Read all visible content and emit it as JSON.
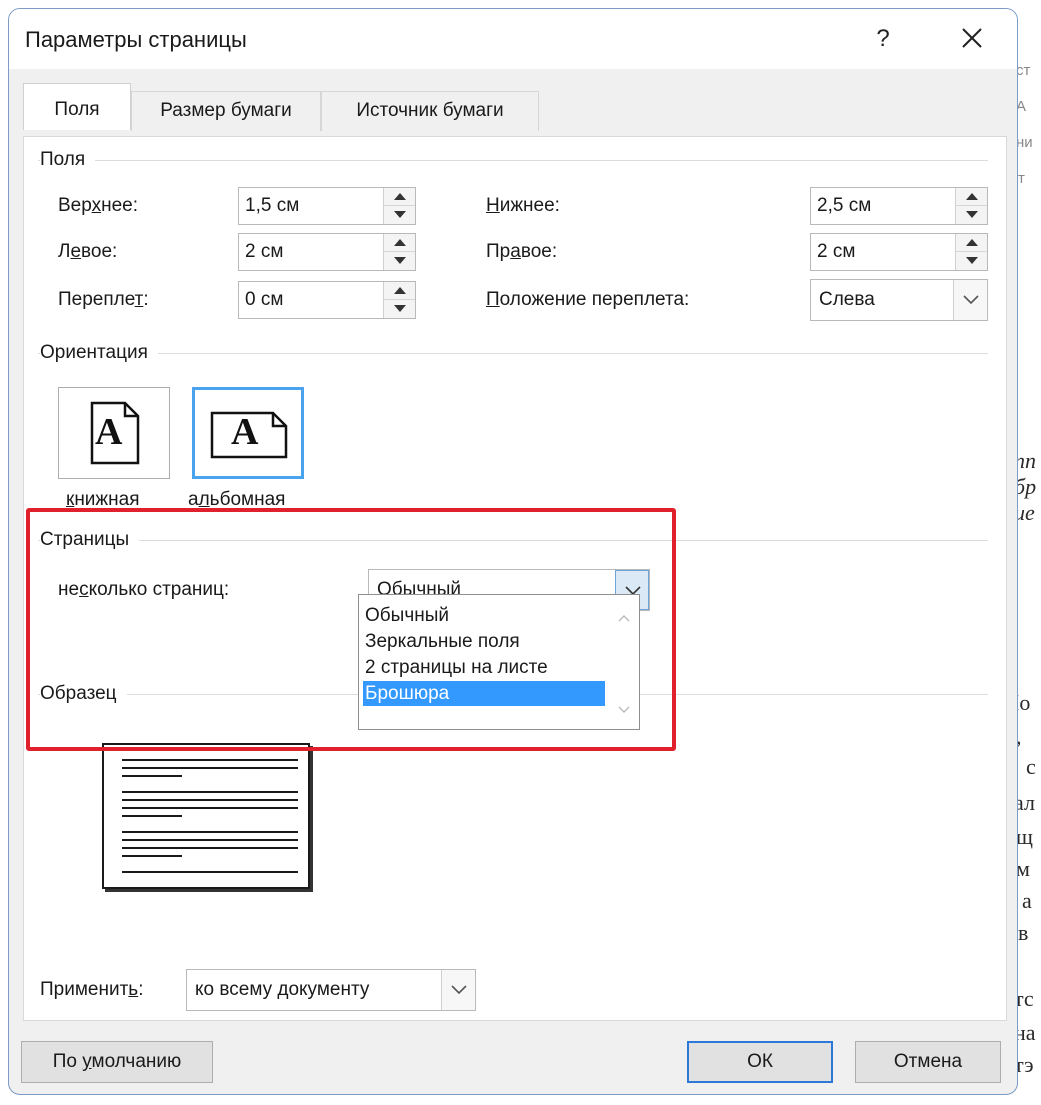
{
  "background_fragments": [
    "ст",
    "А",
    "ни",
    "т",
    "пп",
    "бр",
    "ие",
    "Io",
    ",",
    "с",
    "ал",
    "щ",
    "м",
    "а",
    "в",
    "тс",
    "на",
    "тэ"
  ],
  "dialog": {
    "title": "Параметры страницы",
    "help_label": "?",
    "tabs": [
      "Поля",
      "Размер бумаги",
      "Источник бумаги"
    ],
    "margins": {
      "group_label": "Поля",
      "top": {
        "label_pre": "Вер",
        "label_u": "х",
        "label_post": "нее:",
        "value": "1,5 см"
      },
      "left": {
        "label_pre": "Л",
        "label_u": "е",
        "label_post": "вое:",
        "value": "2 см"
      },
      "gutter": {
        "label_pre": "Перепле",
        "label_u": "т",
        "label_post": ":",
        "value": "0 см"
      },
      "bottom": {
        "label_pre": "",
        "label_u": "Н",
        "label_post": "ижнее:",
        "value": "2,5 см"
      },
      "right": {
        "label_pre": "Пр",
        "label_u": "а",
        "label_post": "вое:",
        "value": "2 см"
      },
      "gutter_position": {
        "label_pre": "",
        "label_u": "П",
        "label_post": "оложение переплета:",
        "value": "Слева"
      }
    },
    "orientation": {
      "group_label": "Ориентация",
      "portrait": {
        "label_pre": "",
        "label_u": "к",
        "label_post": "нижная",
        "glyph": "A"
      },
      "landscape": {
        "label_pre": "а",
        "label_u": "л",
        "label_post": "ьбомная",
        "glyph": "A"
      }
    },
    "pages": {
      "group_label": "Страницы",
      "multiple_label_pre": "не",
      "multiple_label_u": "с",
      "multiple_label_post": "колько страниц:",
      "selected_value": "Обычный",
      "options": [
        "Обычный",
        "Зеркальные поля",
        "2 страницы на листе",
        "Брошюра"
      ],
      "highlighted_option": "Брошюра"
    },
    "preview": {
      "group_label": "Образец"
    },
    "apply": {
      "label_pre": "Применит",
      "label_u": "ь",
      "label_post": ":",
      "value": "ко всему документу"
    },
    "buttons": {
      "default_pre": "По ",
      "default_u": "у",
      "default_post": "молчанию",
      "ok": "ОК",
      "cancel": "Отмена"
    }
  },
  "colors": {
    "highlight_border": "#e0202a",
    "selection": "#3399ff",
    "focus_border": "#2b78d6",
    "orientation_selected": "#4aa3ee"
  }
}
